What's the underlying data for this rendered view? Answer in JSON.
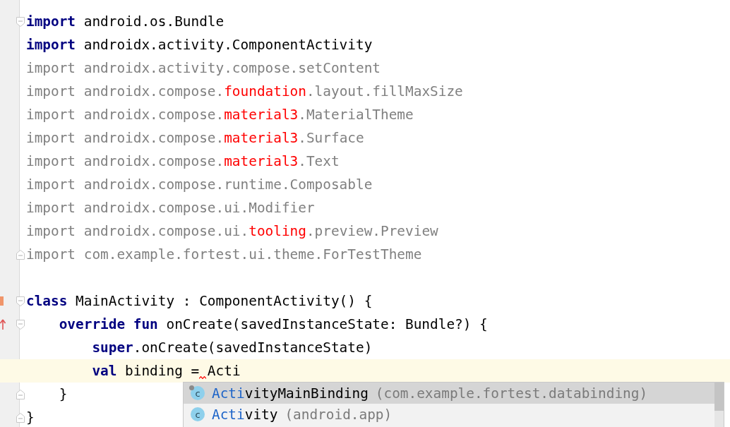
{
  "editor": {
    "lines": [
      {
        "fold_start": true,
        "tokens": [
          {
            "text": "import",
            "kind": "keyword"
          },
          {
            "text": " android.os.Bundle",
            "kind": "plain"
          }
        ]
      },
      {
        "tokens": [
          {
            "text": "import",
            "kind": "keyword"
          },
          {
            "text": " androidx.activity.ComponentActivity",
            "kind": "plain"
          }
        ]
      },
      {
        "tokens": [
          {
            "text": "import androidx.activity.compose.setContent",
            "kind": "unused"
          }
        ]
      },
      {
        "tokens": [
          {
            "text": "import androidx.compose.",
            "kind": "unused"
          },
          {
            "text": "foundation",
            "kind": "error"
          },
          {
            "text": ".layout.fillMaxSize",
            "kind": "unused"
          }
        ]
      },
      {
        "tokens": [
          {
            "text": "import androidx.compose.",
            "kind": "unused"
          },
          {
            "text": "material3",
            "kind": "error"
          },
          {
            "text": ".MaterialTheme",
            "kind": "unused"
          }
        ]
      },
      {
        "tokens": [
          {
            "text": "import androidx.compose.",
            "kind": "unused"
          },
          {
            "text": "material3",
            "kind": "error"
          },
          {
            "text": ".Surface",
            "kind": "unused"
          }
        ]
      },
      {
        "tokens": [
          {
            "text": "import androidx.compose.",
            "kind": "unused"
          },
          {
            "text": "material3",
            "kind": "error"
          },
          {
            "text": ".Text",
            "kind": "unused"
          }
        ]
      },
      {
        "tokens": [
          {
            "text": "import androidx.compose.runtime.Composable",
            "kind": "unused"
          }
        ]
      },
      {
        "tokens": [
          {
            "text": "import androidx.compose.ui.Modifier",
            "kind": "unused"
          }
        ]
      },
      {
        "tokens": [
          {
            "text": "import androidx.compose.ui.",
            "kind": "unused"
          },
          {
            "text": "tooling",
            "kind": "error"
          },
          {
            "text": ".preview.Preview",
            "kind": "unused"
          }
        ]
      },
      {
        "fold_end": true,
        "tokens": [
          {
            "text": "import com.example.fortest.ui.theme.ForTestTheme",
            "kind": "unused"
          }
        ]
      },
      {
        "separated": true,
        "fold_start": true,
        "implemented": true,
        "tokens": [
          {
            "text": "class",
            "kind": "keyword"
          },
          {
            "text": " MainActivity : ComponentActivity() {",
            "kind": "plain"
          }
        ],
        "children": [
          {
            "fold_start": true,
            "overrides": true,
            "tokens": [
              {
                "text": "override fun",
                "kind": "keyword"
              },
              {
                "text": " onCreate(savedInstanceState: Bundle?) {",
                "kind": "plain"
              }
            ],
            "children": [
              {
                "tokens": [
                  {
                    "text": "super",
                    "kind": "keyword"
                  },
                  {
                    "text": ".onCreate(savedInstanceState)",
                    "kind": "plain"
                  }
                ]
              },
              {
                "current": true,
                "tokens": [
                  {
                    "text": "val",
                    "kind": "keyword"
                  },
                  {
                    "text": " binding =",
                    "kind": "plain"
                  },
                  {
                    "text": "Acti",
                    "kind": "plain",
                    "squiggle": true
                  }
                ]
              }
            ]
          },
          {
            "fold_end": true,
            "tokens": [
              {
                "text": "}",
                "kind": "plain"
              }
            ]
          }
        ]
      },
      {
        "fold_end": true,
        "tokens": [
          {
            "text": "}",
            "kind": "plain"
          }
        ]
      }
    ]
  },
  "completion": {
    "items": [
      {
        "icon_letter": "c",
        "pinned": true,
        "match": "Acti",
        "rest": "vityMainBinding",
        "detail": "(com.example.fortest.databinding)",
        "selected": true
      },
      {
        "icon_letter": "c",
        "pinned": false,
        "match": "Acti",
        "rest": "vity",
        "detail": "(android.app)",
        "selected": false
      }
    ]
  }
}
